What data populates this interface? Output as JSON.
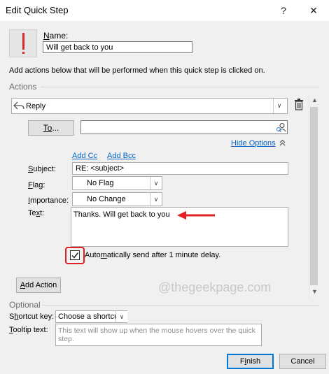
{
  "window": {
    "title": "Edit Quick Step",
    "help_label": "?",
    "close_label": "✕"
  },
  "name_field": {
    "label_u": "N",
    "label_rest": "ame:",
    "value": "Will get back to you"
  },
  "instructions": "Add actions below that will be performed when this quick step is clicked on.",
  "sections": {
    "actions": "Actions",
    "optional": "Optional"
  },
  "action": {
    "value": "Reply",
    "to_label_u": "To",
    "to_label_rest": "...",
    "to_value": "",
    "hide_options_u": "H",
    "hide_options_rest": "ide Options",
    "add_cc": "Add Cc",
    "add_bcc": "Add Bcc",
    "subject_label_u": "S",
    "subject_label_rest": "ubject:",
    "subject_value": "RE: <subject>",
    "flag_label_u": "F",
    "flag_label_rest": "lag:",
    "flag_value": "No Flag",
    "importance_label_u": "I",
    "importance_label_rest": "mportance:",
    "importance_value": "No Change",
    "text_label_pre": "Te",
    "text_label_u": "x",
    "text_label_rest": "t:",
    "text_value": "Thanks. Will get back to you",
    "auto_send_pre": "Auto",
    "auto_send_u": "m",
    "auto_send_rest": "atically send after 1 minute delay.",
    "auto_send_checked": true
  },
  "add_action": {
    "label_u": "A",
    "label_rest": "dd Action"
  },
  "watermark": "@thegeekpage.com",
  "shortcut": {
    "label_pre": "S",
    "label_u": "h",
    "label_rest": "ortcut key:",
    "value": "Choose a shortcut"
  },
  "tooltip": {
    "label_u": "T",
    "label_rest": "ooltip text:",
    "placeholder": "This text will show up when the mouse hovers over the quick step."
  },
  "footer": {
    "finish_label_pre": "F",
    "finish_label_u": "i",
    "finish_label_rest": "nish",
    "cancel_label": "Cancel"
  },
  "icons": {
    "quickstep": "exclamation-icon",
    "reply": "reply-arrow-icon",
    "delete": "trash-icon",
    "address_book": "address-book-icon",
    "chevron": "chevron-down-icon",
    "hide_options": "double-chevron-up-icon",
    "annotation_arrow": "red-arrow-icon"
  },
  "colors": {
    "accent": "#0078d7",
    "link": "#0563c1",
    "annotation": "#e21f26",
    "dialog_bg": "#f0f0f0"
  }
}
